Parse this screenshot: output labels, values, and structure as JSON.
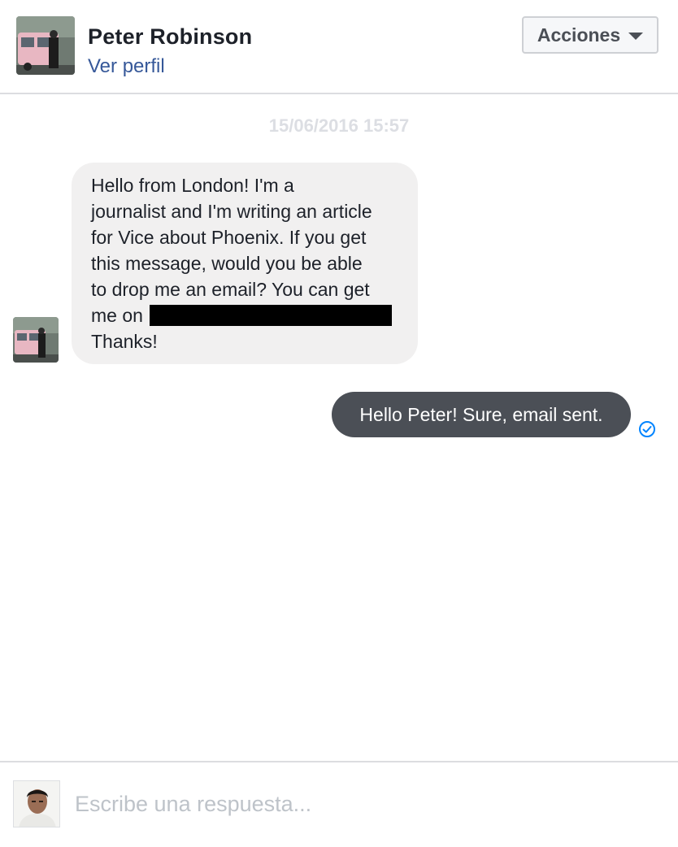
{
  "header": {
    "contact_name": "Peter Robinson",
    "profile_link": "Ver perfil",
    "actions_label": "Acciones"
  },
  "conversation": {
    "timestamp": "15/06/2016 15:57",
    "incoming_message": {
      "lines": [
        "Hello from London! I'm a",
        "journalist and I'm writing an article",
        "for Vice about Phoenix. If you get",
        "this message, would you be able",
        "to drop me an email? You can get",
        "me on",
        "Thanks!"
      ]
    },
    "outgoing_message": {
      "text": "Hello Peter! Sure, email sent."
    }
  },
  "composer": {
    "placeholder": "Escribe una respuesta..."
  },
  "colors": {
    "link": "#365899",
    "outgoing_bubble": "#4b4f56",
    "incoming_bubble": "#f1f0f0",
    "sent_indicator": "#0084ff"
  },
  "icons": {
    "actions_dropdown": "caret-down-icon",
    "delivery_status": "check-circle-icon"
  }
}
